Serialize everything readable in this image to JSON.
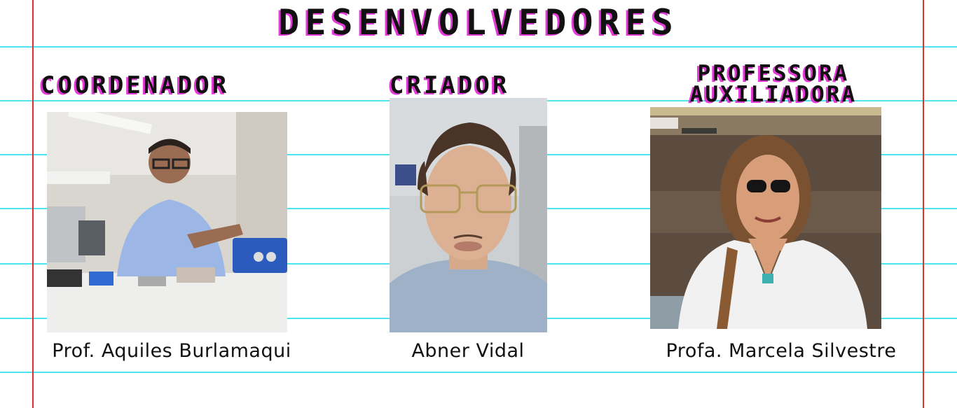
{
  "page": {
    "title": "DESENVOLVEDORES"
  },
  "colors": {
    "line_blue": "#4fe3f0",
    "margin_red": "#e0302b",
    "title_shadow": "#e43ad8",
    "text": "#111111"
  },
  "developers": [
    {
      "role": "COORDENADOR",
      "name": "Prof. Aquiles Burlamaqui",
      "photo_icon": "photo-man-with-robot"
    },
    {
      "role": "CRIADOR",
      "name": "Abner Vidal",
      "photo_icon": "photo-young-man-glasses"
    },
    {
      "role": "PROFESSORA AUXILIADORA",
      "name": "Profa. Marcela Silvestre",
      "photo_icon": "photo-woman-sunglasses"
    }
  ]
}
